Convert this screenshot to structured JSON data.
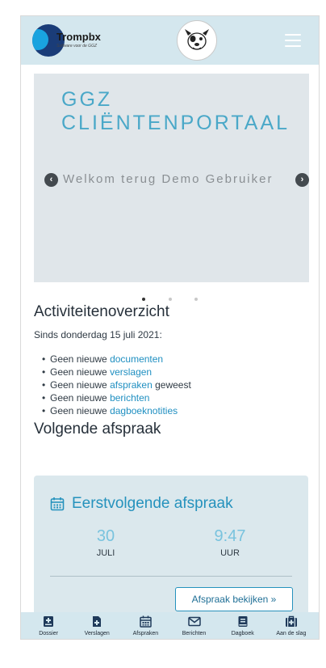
{
  "header": {
    "logo_name": "Trompbx",
    "logo_tagline": "Software voor de GGZ"
  },
  "carousel": {
    "title_line1": "GGZ",
    "title_line2": "CLIËNTENPORTAAL",
    "welcome": "Welkom terug Demo Gebruiker",
    "prev_arrow": "‹",
    "next_arrow": "›",
    "slide_count": 3,
    "active_slide": 1
  },
  "activity": {
    "heading": "Activiteitenoverzicht",
    "since": "Sinds donderdag 15 juli 2021:",
    "items": [
      {
        "prefix": "Geen nieuwe ",
        "link": "documenten",
        "suffix": ""
      },
      {
        "prefix": "Geen nieuwe ",
        "link": "verslagen",
        "suffix": ""
      },
      {
        "prefix": "Geen nieuwe ",
        "link": "afspraken",
        "suffix": " geweest"
      },
      {
        "prefix": "Geen nieuwe ",
        "link": "berichten",
        "suffix": ""
      },
      {
        "prefix": "Geen nieuwe ",
        "link": "dagboeknotities",
        "suffix": ""
      }
    ]
  },
  "appointment": {
    "heading": "Volgende afspraak",
    "card_title": "Eerstvolgende afspraak",
    "day": "30",
    "month": "JULI",
    "time": "9:47",
    "time_unit": "UUR",
    "view_button": "Afspraak bekijken »"
  },
  "bottom_nav": [
    {
      "label": "Dossier",
      "icon": "dossier-icon"
    },
    {
      "label": "Verslagen",
      "icon": "verslagen-icon"
    },
    {
      "label": "Afspraken",
      "icon": "calendar-icon"
    },
    {
      "label": "Berichten",
      "icon": "envelope-icon"
    },
    {
      "label": "Dagboek",
      "icon": "book-icon"
    },
    {
      "label": "Aan de slag",
      "icon": "medkit-icon"
    }
  ],
  "colors": {
    "header_bg": "#d4e7ee",
    "accent": "#2592bd",
    "link": "#1f8fc1",
    "nav_icon": "#1f3a5a"
  }
}
